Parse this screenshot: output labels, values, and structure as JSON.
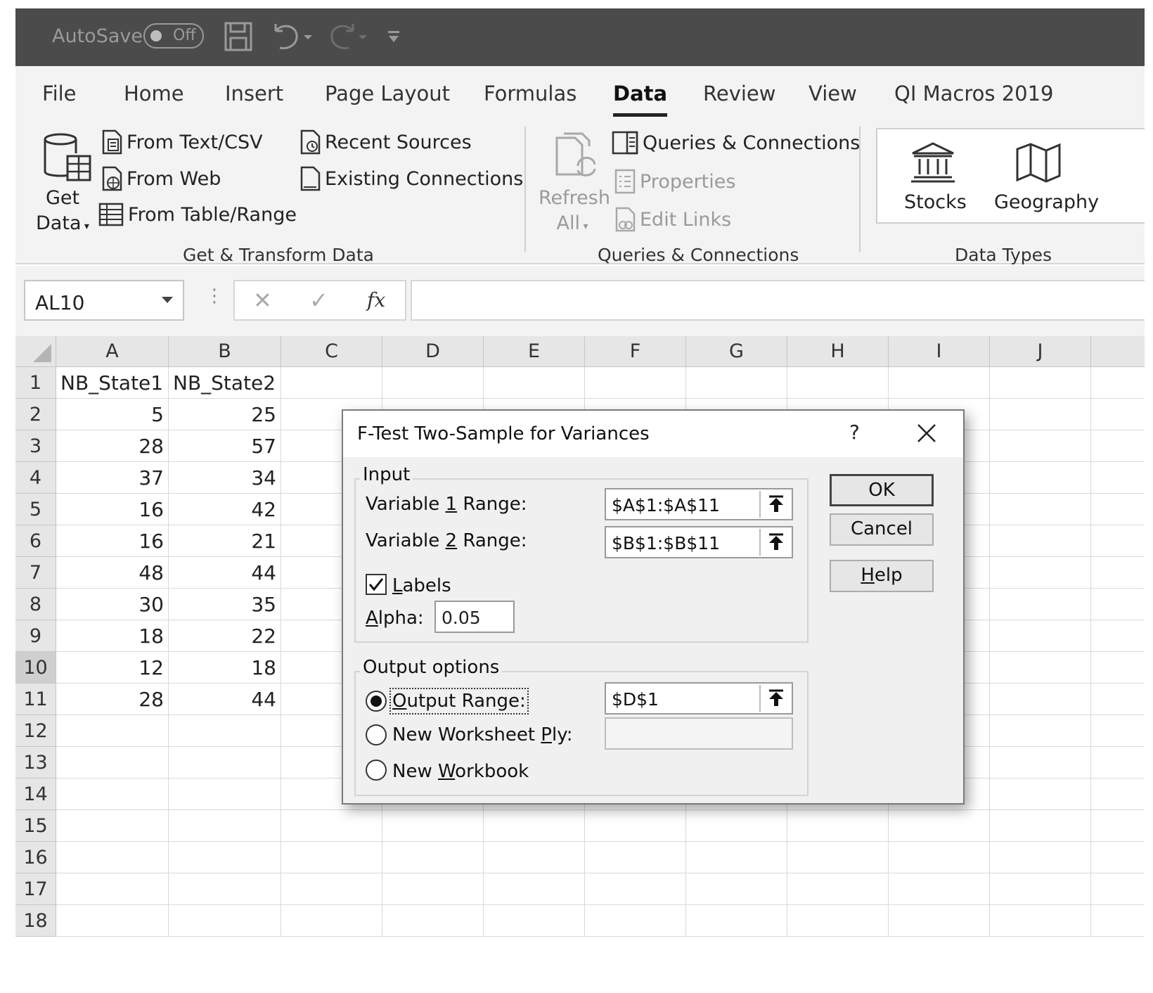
{
  "titlebar": {
    "autosave_label": "AutoSave",
    "autosave_state": "Off"
  },
  "ribbon_tabs": [
    "File",
    "Home",
    "Insert",
    "Page Layout",
    "Formulas",
    "Data",
    "Review",
    "View",
    "QI Macros 2019"
  ],
  "active_tab": "Data",
  "ribbon": {
    "get_data_line1": "Get",
    "get_data_line2": "Data",
    "from_text_csv": "From Text/CSV",
    "from_web": "From Web",
    "from_table_range": "From Table/Range",
    "recent_sources": "Recent Sources",
    "existing_connections": "Existing Connections",
    "group_get_transform": "Get & Transform Data",
    "refresh_line1": "Refresh",
    "refresh_line2": "All",
    "queries_connections": "Queries & Connections",
    "properties": "Properties",
    "edit_links": "Edit Links",
    "group_queries": "Queries & Connections",
    "stocks": "Stocks",
    "geography": "Geography",
    "group_data_types": "Data Types"
  },
  "formula_bar": {
    "name_box": "AL10",
    "fx_label": "fx",
    "formula": ""
  },
  "sheet": {
    "columns": [
      "A",
      "B",
      "C",
      "D",
      "E",
      "F",
      "G",
      "H",
      "I",
      "J"
    ],
    "rows": [
      "1",
      "2",
      "3",
      "4",
      "5",
      "6",
      "7",
      "8",
      "9",
      "10",
      "11",
      "12",
      "13",
      "14",
      "15",
      "16",
      "17",
      "18"
    ],
    "selected_row": "10",
    "header_a": "NB_State1",
    "header_b": "NB_State2",
    "col_a": [
      "5",
      "28",
      "37",
      "16",
      "16",
      "48",
      "30",
      "18",
      "12",
      "28"
    ],
    "col_b": [
      "25",
      "57",
      "34",
      "42",
      "21",
      "44",
      "35",
      "22",
      "18",
      "44"
    ]
  },
  "dialog": {
    "title": "F-Test Two-Sample for Variances",
    "help_glyph": "?",
    "input_legend": "Input",
    "var1_label_pre": "Variable ",
    "var1_label_key": "1",
    "var1_label_post": " Range:",
    "var1_value": "$A$1:$A$11",
    "var2_label_pre": "Variable ",
    "var2_label_key": "2",
    "var2_label_post": " Range:",
    "var2_value": "$B$1:$B$11",
    "labels_key": "L",
    "labels_rest": "abels",
    "labels_checked": true,
    "alpha_key": "A",
    "alpha_rest": "lpha:",
    "alpha_value": "0.05",
    "output_legend": "Output options",
    "output_range_key": "O",
    "output_range_rest": "utput Range:",
    "output_range_value": "$D$1",
    "new_ply_pre": "New Worksheet ",
    "new_ply_key": "P",
    "new_ply_post": "ly:",
    "new_ply_value": "",
    "new_wb_pre": "New ",
    "new_wb_key": "W",
    "new_wb_post": "orkbook",
    "selected_output": "Output Range",
    "ok": "OK",
    "cancel": "Cancel",
    "help_key": "H",
    "help_rest": "elp"
  }
}
